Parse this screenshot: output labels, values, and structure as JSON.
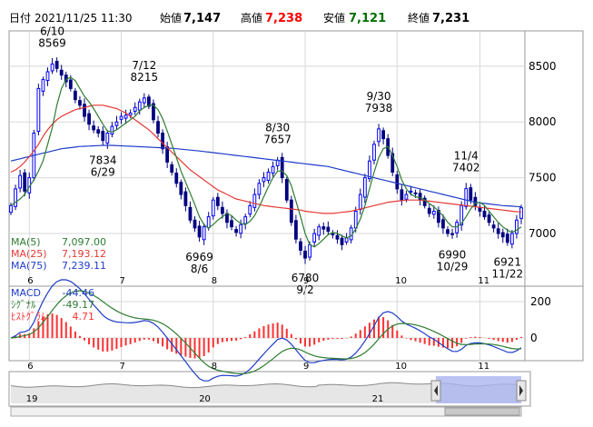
{
  "header": {
    "date_label": "日付",
    "datetime": "2021/11/25 11:30",
    "open_label": "始値",
    "open": "7,147",
    "high_label": "高値",
    "high": "7,238",
    "low_label": "安値",
    "low": "7,121",
    "close_label": "終値",
    "close": "7,231"
  },
  "colors": {
    "up": "#0000ff",
    "down": "#000080",
    "ma5": "#2e7d32",
    "ma25": "#e53935",
    "ma75": "#1e3cc8",
    "macd": "#1e3cc8",
    "signal": "#2e7d32",
    "hist": "#ff3030",
    "high_value": "#ff0000",
    "low_value": "#007000",
    "navigator_fill": "#aab4f0"
  },
  "chart_data": [
    {
      "type": "candlestick",
      "ylim": [
        6650,
        8800
      ],
      "yticks": [
        7000,
        7500,
        8000,
        8500
      ],
      "x_month_labels": [
        {
          "label": "6",
          "index": 4
        },
        {
          "label": "7",
          "index": 24
        },
        {
          "label": "8",
          "index": 44
        },
        {
          "label": "9",
          "index": 64
        },
        {
          "label": "10",
          "index": 84
        },
        {
          "label": "11",
          "index": 102
        }
      ],
      "closes": [
        7250,
        7400,
        7520,
        7380,
        7500,
        7900,
        8300,
        8380,
        8450,
        8520,
        8480,
        8420,
        8360,
        8300,
        8200,
        8150,
        8050,
        7980,
        7930,
        7900,
        7834,
        7900,
        7960,
        8000,
        8050,
        8060,
        8080,
        8130,
        8180,
        8215,
        8140,
        8020,
        7900,
        7760,
        7640,
        7550,
        7450,
        7350,
        7250,
        7120,
        7050,
        6969,
        7060,
        7150,
        7300,
        7250,
        7180,
        7100,
        7060,
        7010,
        7080,
        7150,
        7250,
        7350,
        7450,
        7500,
        7550,
        7600,
        7657,
        7500,
        7300,
        7100,
        6950,
        6850,
        6780,
        6900,
        7000,
        7060,
        7040,
        7020,
        6990,
        6950,
        6900,
        6960,
        7050,
        7200,
        7350,
        7500,
        7650,
        7800,
        7938,
        7850,
        7700,
        7550,
        7400,
        7300,
        7350,
        7380,
        7360,
        7300,
        7250,
        7180,
        7200,
        7100,
        7050,
        7000,
        6990,
        7100,
        7250,
        7402,
        7300,
        7250,
        7200,
        7150,
        7100,
        7050,
        7000,
        6970,
        6921,
        7000,
        7120,
        7231
      ],
      "ma5": [
        7250,
        7280,
        7310,
        7350,
        7420,
        7480,
        7560,
        7650,
        7800,
        7950,
        8150,
        8300,
        8380,
        8400,
        8370,
        8300,
        8230,
        8180,
        8120,
        8050,
        7980,
        7920,
        7910,
        7930,
        7960,
        7990,
        8020,
        8050,
        8100,
        8130,
        8150,
        8150,
        8110,
        8030,
        7920,
        7800,
        7680,
        7560,
        7460,
        7360,
        7260,
        7150,
        7080,
        7050,
        7080,
        7120,
        7150,
        7180,
        7160,
        7120,
        7090,
        7080,
        7110,
        7160,
        7240,
        7330,
        7420,
        7500,
        7560,
        7560,
        7520,
        7430,
        7290,
        7150,
        7000,
        6900,
        6880,
        6910,
        6950,
        6990,
        7010,
        7000,
        6980,
        6960,
        6980,
        7040,
        7130,
        7250,
        7400,
        7550,
        7680,
        7760,
        7780,
        7700,
        7600,
        7480,
        7400,
        7350,
        7330,
        7320,
        7300,
        7270,
        7240,
        7200,
        7160,
        7100,
        7060,
        7060,
        7090,
        7150,
        7220,
        7270,
        7280,
        7250,
        7200,
        7150,
        7100,
        7060,
        7030,
        7010,
        7030,
        7060
      ],
      "ma25": [
        7550,
        7570,
        7600,
        7640,
        7690,
        7740,
        7800,
        7870,
        7930,
        7980,
        8020,
        8050,
        8070,
        8090,
        8110,
        8120,
        8130,
        8140,
        8150,
        8150,
        8150,
        8140,
        8130,
        8120,
        8100,
        8080,
        8050,
        8020,
        7990,
        7960,
        7930,
        7890,
        7850,
        7810,
        7770,
        7730,
        7690,
        7650,
        7610,
        7570,
        7540,
        7510,
        7480,
        7450,
        7420,
        7390,
        7370,
        7350,
        7330,
        7310,
        7300,
        7290,
        7280,
        7270,
        7260,
        7250,
        7245,
        7240,
        7235,
        7230,
        7225,
        7220,
        7215,
        7210,
        7200,
        7195,
        7190,
        7185,
        7180,
        7180,
        7180,
        7185,
        7190,
        7195,
        7200,
        7210,
        7220,
        7230,
        7240,
        7250,
        7260,
        7270,
        7280,
        7285,
        7290,
        7295,
        7300,
        7300,
        7300,
        7300,
        7295,
        7290,
        7285,
        7280,
        7275,
        7270,
        7265,
        7260,
        7255,
        7250,
        7245,
        7240,
        7235,
        7230,
        7225,
        7220,
        7215,
        7210,
        7205,
        7200,
        7196,
        7193
      ],
      "ma75": [
        7650,
        7660,
        7670,
        7680,
        7690,
        7700,
        7710,
        7720,
        7730,
        7740,
        7750,
        7760,
        7765,
        7770,
        7775,
        7780,
        7782,
        7784,
        7786,
        7788,
        7790,
        7790,
        7790,
        7788,
        7786,
        7784,
        7782,
        7780,
        7778,
        7776,
        7774,
        7772,
        7770,
        7768,
        7766,
        7764,
        7760,
        7756,
        7752,
        7748,
        7744,
        7740,
        7735,
        7730,
        7725,
        7720,
        7715,
        7710,
        7705,
        7700,
        7695,
        7690,
        7685,
        7680,
        7675,
        7670,
        7665,
        7660,
        7655,
        7650,
        7645,
        7640,
        7635,
        7630,
        7625,
        7620,
        7615,
        7610,
        7605,
        7600,
        7590,
        7580,
        7570,
        7560,
        7550,
        7540,
        7530,
        7520,
        7510,
        7500,
        7490,
        7480,
        7470,
        7460,
        7450,
        7440,
        7430,
        7420,
        7410,
        7400,
        7390,
        7380,
        7370,
        7360,
        7350,
        7340,
        7330,
        7320,
        7310,
        7300,
        7290,
        7280,
        7275,
        7270,
        7265,
        7260,
        7255,
        7250,
        7248,
        7245,
        7242,
        7239
      ],
      "annotations": [
        {
          "date": "6/10",
          "value": "8569",
          "pos": "above",
          "index": 9
        },
        {
          "date": "7/12",
          "value": "8215",
          "pos": "above",
          "index": 29
        },
        {
          "date": "7834",
          "value": "6/29",
          "pos": "below",
          "index": 20
        },
        {
          "date": "6969",
          "value": "8/6",
          "pos": "below",
          "index": 41
        },
        {
          "date": "8/30",
          "value": "7657",
          "pos": "above",
          "index": 58
        },
        {
          "date": "6780",
          "value": "9/2",
          "pos": "below",
          "index": 64
        },
        {
          "date": "9/30",
          "value": "7938",
          "pos": "above",
          "index": 80
        },
        {
          "date": "6990",
          "value": "10/29",
          "pos": "below",
          "index": 96
        },
        {
          "date": "11/4",
          "value": "7402",
          "pos": "above",
          "index": 99
        },
        {
          "date": "6921",
          "value": "11/22",
          "pos": "below",
          "index": 108
        }
      ],
      "legend": [
        {
          "label": "MA(5)",
          "value": "7,097.00",
          "color": "#2e7d32"
        },
        {
          "label": "MA(25)",
          "value": "7,193.12",
          "color": "#e53935"
        },
        {
          "label": "MA(75)",
          "value": "7,239.11",
          "color": "#1e3cc8"
        }
      ]
    },
    {
      "type": "macd",
      "ylim": [
        -110,
        270
      ],
      "yticks": [
        0,
        200
      ],
      "x_month_labels": [
        {
          "label": "6",
          "index": 4
        },
        {
          "label": "7",
          "index": 24
        },
        {
          "label": "8",
          "index": 44
        },
        {
          "label": "9",
          "index": 64
        },
        {
          "label": "10",
          "index": 84
        },
        {
          "label": "11",
          "index": 102
        }
      ],
      "legend": [
        {
          "label": "MACD",
          "value": "-44.46",
          "color": "#1e3cc8"
        },
        {
          "label": "ｼｸﾞﾅﾙ",
          "value": "-49.17",
          "color": "#2e7d32"
        },
        {
          "label": "ﾋｽﾄｸﾞﾗﾑ",
          "value": "4.71",
          "color": "#ff3030"
        }
      ]
    },
    {
      "type": "area",
      "x_labels": [
        {
          "label": "19",
          "pos": 0.03
        },
        {
          "label": "20",
          "pos": 0.37
        },
        {
          "label": "21",
          "pos": 0.71
        }
      ]
    }
  ]
}
